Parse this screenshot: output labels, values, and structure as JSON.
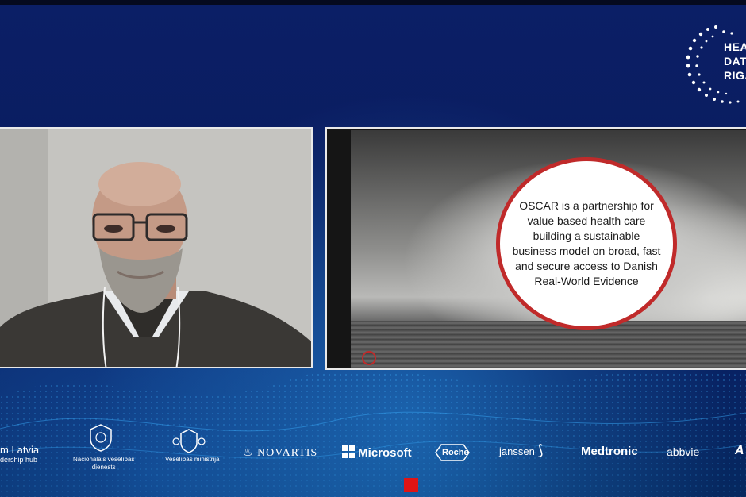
{
  "branding": {
    "event_logo_lines": [
      "HEAL",
      "DATA",
      "RIGA"
    ]
  },
  "slide": {
    "circle_text": "OSCAR is a partnership for value based health care building a sustainable business model on broad, fast and secure access to Danish Real-World Evidence"
  },
  "sponsors": {
    "latvia_line1": "m Latvia",
    "latvia_line2": "dership hub",
    "nvd_line1": "Nacionālais veselības",
    "nvd_line2": "dienests",
    "ministry": "Veselības ministrija",
    "novartis": "NOVARTIS",
    "microsoft": "Microsoft",
    "roche": "Roche",
    "janssen": "janssen",
    "medtronic": "Medtronic",
    "abbvie": "abbvie",
    "partial": "A"
  },
  "colors": {
    "background": "#0a1c5e",
    "circle_border": "#c02a2a",
    "record_indicator": "#e01515"
  }
}
